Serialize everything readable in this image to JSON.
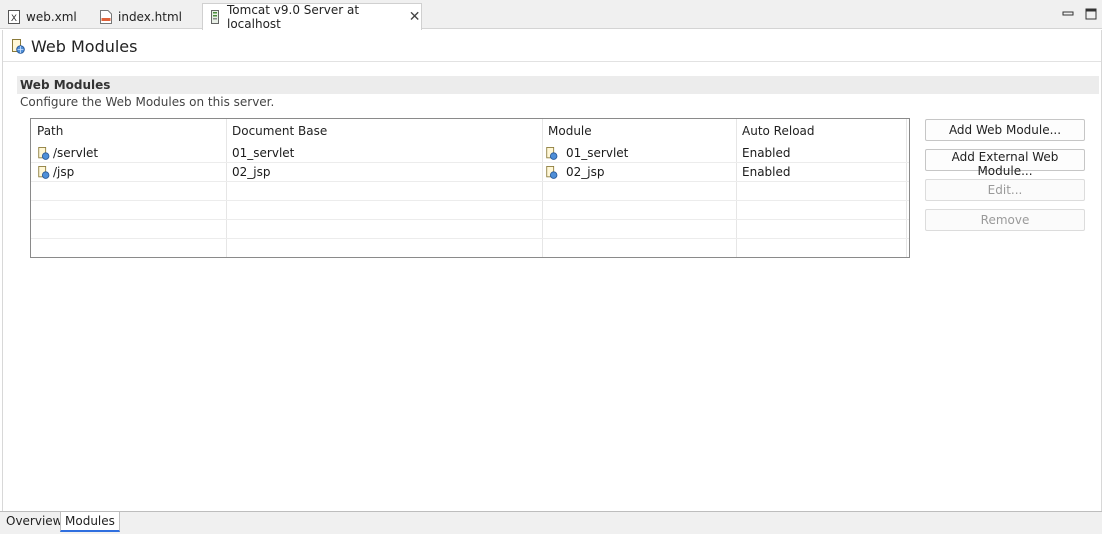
{
  "tabs": [
    {
      "label": "web.xml",
      "icon": "xml-file-icon"
    },
    {
      "label": "index.html",
      "icon": "html-file-icon"
    },
    {
      "label": "Tomcat v9.0 Server at localhost",
      "icon": "server-icon",
      "active": true
    }
  ],
  "window": {
    "minimize_icon": "minimize-icon",
    "maximize_icon": "maximize-icon"
  },
  "page": {
    "title": "Web Modules",
    "icon": "web-module-icon"
  },
  "section": {
    "title": "Web Modules",
    "description": "Configure the Web Modules on this server."
  },
  "table": {
    "columns": [
      "Path",
      "Document Base",
      "Module",
      "Auto Reload"
    ],
    "rows": [
      {
        "path": "/servlet",
        "document_base": "01_servlet",
        "module": "01_servlet",
        "auto_reload": "Enabled"
      },
      {
        "path": "/jsp",
        "document_base": "02_jsp",
        "module": "02_jsp",
        "auto_reload": "Enabled"
      }
    ]
  },
  "buttons": {
    "add_web_module": "Add Web Module...",
    "add_external_web_module": "Add External Web Module...",
    "edit": "Edit...",
    "remove": "Remove"
  },
  "bottom_tabs": [
    {
      "label": "Overview"
    },
    {
      "label": "Modules",
      "active": true
    }
  ],
  "colors": {
    "accent": "#2f6fdf",
    "section_bg": "#ececec"
  }
}
